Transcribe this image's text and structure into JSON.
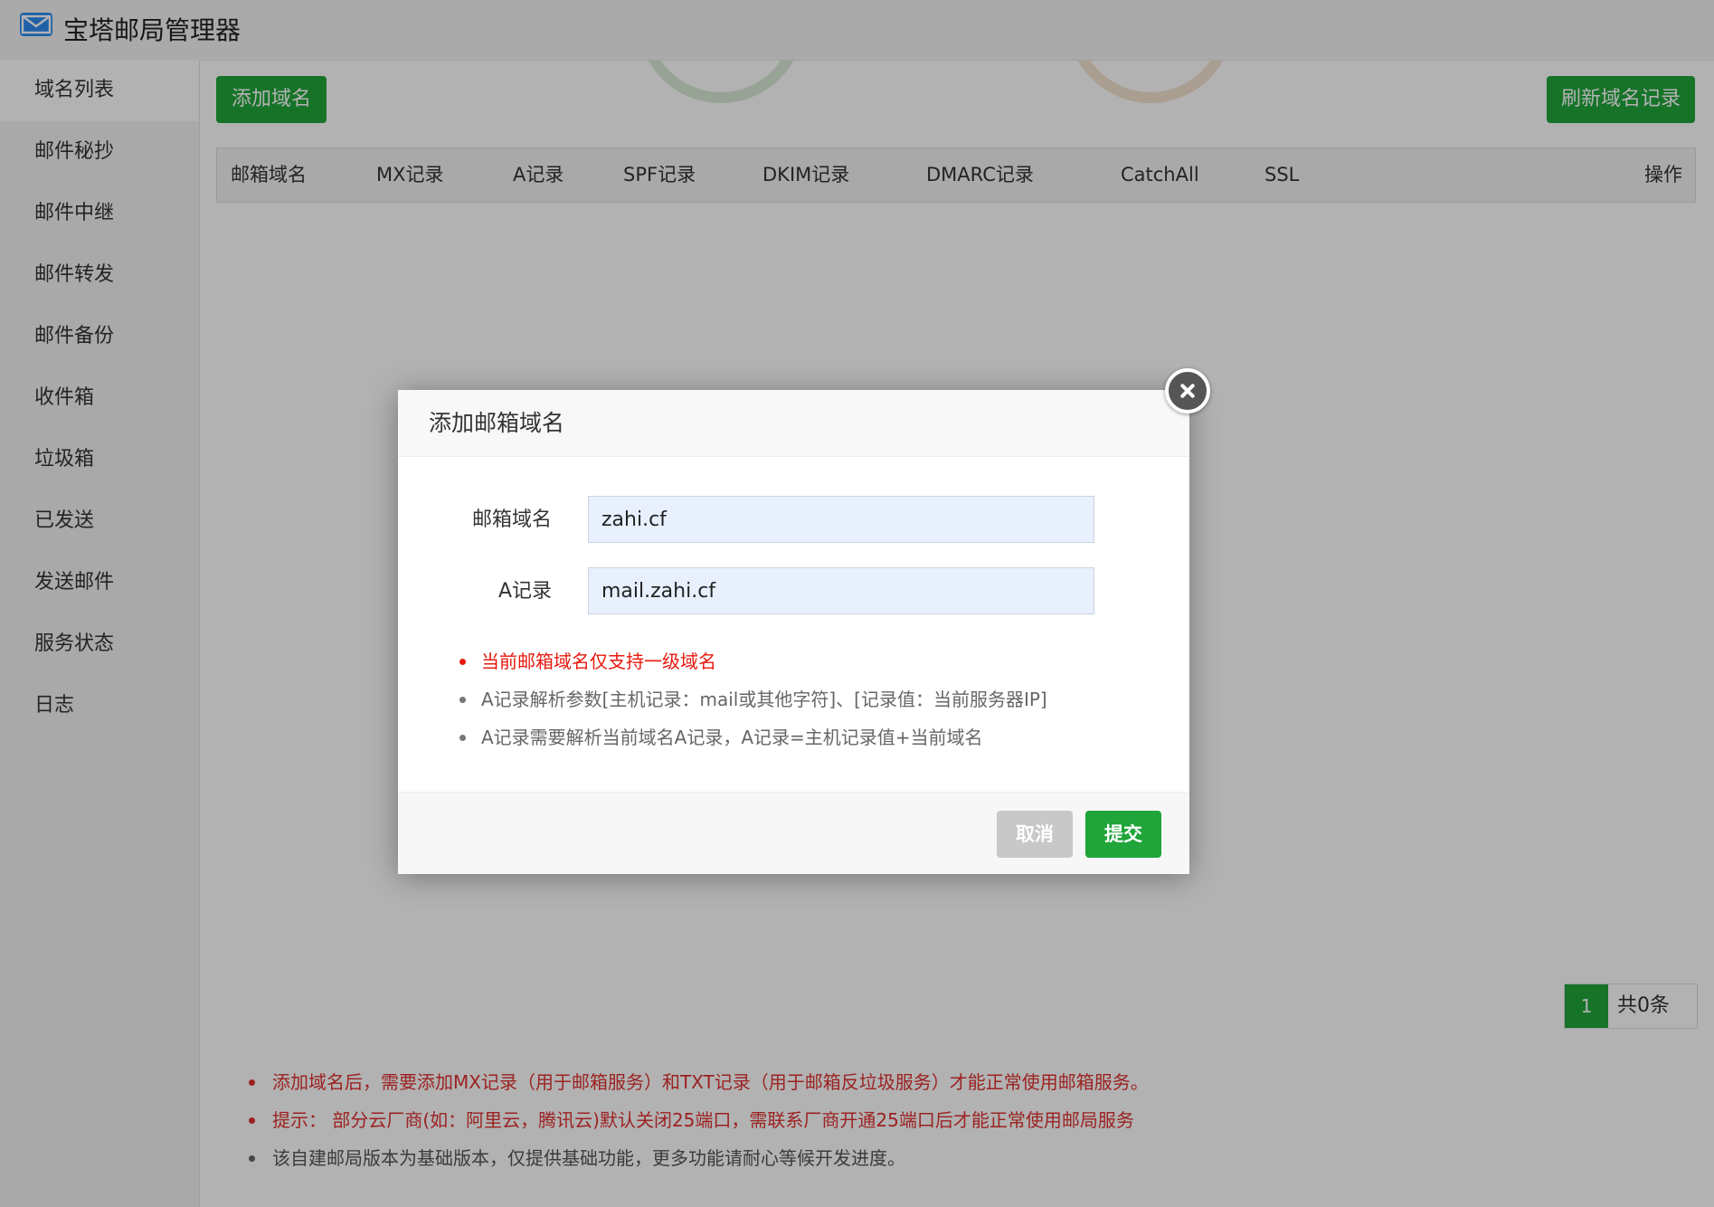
{
  "app": {
    "title": "宝塔邮局管理器"
  },
  "sidebar": {
    "items": [
      {
        "label": "域名列表"
      },
      {
        "label": "邮件秘抄"
      },
      {
        "label": "邮件中继"
      },
      {
        "label": "邮件转发"
      },
      {
        "label": "邮件备份"
      },
      {
        "label": "收件箱"
      },
      {
        "label": "垃圾箱"
      },
      {
        "label": "已发送"
      },
      {
        "label": "发送邮件"
      },
      {
        "label": "服务状态"
      },
      {
        "label": "日志"
      }
    ],
    "active": "域名列表"
  },
  "toolbar": {
    "add_label": "添加域名",
    "refresh_label": "刷新域名记录"
  },
  "table": {
    "columns": [
      "邮箱域名",
      "MX记录",
      "A记录",
      "SPF记录",
      "DKIM记录",
      "DMARC记录",
      "CatchAll",
      "SSL",
      "操作"
    ]
  },
  "pager": {
    "current": "1",
    "total": "共0条"
  },
  "tips": [
    "添加域名后，需要添加MX记录（用于邮箱服务）和TXT记录（用于邮箱反垃圾服务）才能正常使用邮箱服务。",
    "提示： 部分云厂商(如：阿里云，腾讯云)默认关闭25端口，需联系厂商开通25端口后才能正常使用邮局服务",
    "该自建邮局版本为基础版本，仅提供基础功能，更多功能请耐心等候开发进度。"
  ],
  "dialog": {
    "title": "添加邮箱域名",
    "fields": {
      "domain": {
        "label": "邮箱域名",
        "value": "zahi.cf"
      },
      "a_record": {
        "label": "A记录",
        "value": "mail.zahi.cf"
      }
    },
    "tips": [
      "当前邮箱域名仅支持一级域名",
      "A记录解析参数[主机记录：mail或其他字符]、[记录值：当前服务器IP]",
      "A记录需要解析当前域名A记录，A记录=主机记录值+当前域名"
    ],
    "cancel_label": "取消",
    "submit_label": "提交"
  },
  "colors": {
    "accent": "#20a53a",
    "warning": "#e8190f",
    "overlay": "rgba(0,0,0,0.3)"
  }
}
